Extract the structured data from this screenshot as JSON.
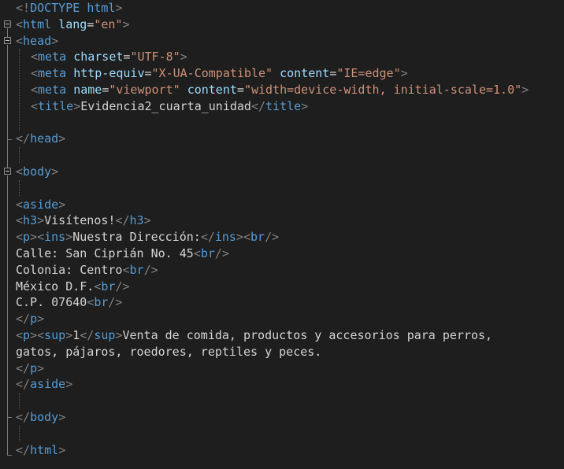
{
  "editor": {
    "language": "html",
    "theme_colors": {
      "background": "#1e1e1e",
      "punctuation": "#808080",
      "tag": "#569cd6",
      "attribute": "#9cdcfe",
      "value": "#ce9178",
      "text": "#d4d4d4"
    },
    "lines": [
      "<!DOCTYPE html>",
      "<html lang=\"en\">",
      "<head>",
      "<meta charset=\"UTF-8\">",
      "<meta http-equiv=\"X-UA-Compatible\" content=\"IE=edge\">",
      "<meta name=\"viewport\" content=\"width=device-width, initial-scale=1.0\">",
      "<title>Evidencia2_cuarta_unidad</title>",
      "",
      "</head>",
      "",
      "<body>",
      "",
      "<aside>",
      "<h3>Visítenos!</h3>",
      "<p><ins>Nuestra Dirección:</ins><br/>",
      "Calle: San Ciprián No. 45<br/>",
      "Colonia: Centro<br/>",
      "México D.F.<br/>",
      "C.P. 07640<br/>",
      "</p>",
      "<p><sup>1</sup>Venta de comida, productos y accesorios para perros,",
      "gatos, pájaros, roedores, reptiles y peces.",
      "</p>",
      "</aside>",
      "",
      "</body>",
      "",
      "</html>"
    ]
  }
}
